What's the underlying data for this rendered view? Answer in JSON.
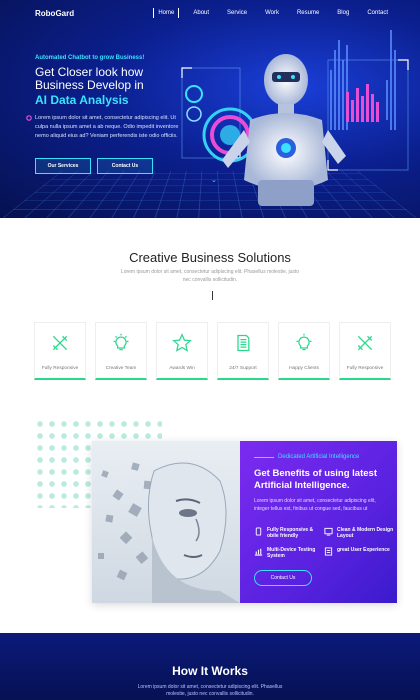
{
  "nav": {
    "logo": "RoboGard",
    "items": [
      "Home",
      "About",
      "Service",
      "Work",
      "Resume",
      "Blog",
      "Contact"
    ]
  },
  "hero": {
    "tagline": "Automated Chatbot to grow Business!",
    "heading_line1": "Get Closer look how",
    "heading_line2": "Business Develop in",
    "heading_highlight": "AI Data Analysis",
    "paragraph": "Lorem ipsum dolor sit amet, consectetur adipiscing elit. Ut culpa nulla ipsum amet a ab neque. Odio impedit inventore nemo aliquid eius ad? Veniam perferendis iste odio officiis.",
    "btn_services": "Our Services",
    "btn_contact": "Contact Us"
  },
  "solutions": {
    "title": "Creative Business Solutions",
    "subtitle": "Lorem ipsum dolor sit amet, consectetur adipiscing elit. Phasellus molestie, justo nec convallis sollicitudin.",
    "features": [
      {
        "label": "Fully Responsive",
        "icon": "tools-icon"
      },
      {
        "label": "Creative Team",
        "icon": "lightbulb-icon"
      },
      {
        "label": "Awards Win",
        "icon": "star-icon"
      },
      {
        "label": "24/7 Support",
        "icon": "document-icon"
      },
      {
        "label": "Happy Clients",
        "icon": "lightbulb-icon"
      },
      {
        "label": "Fully Responsive",
        "icon": "tools-icon"
      }
    ]
  },
  "ai": {
    "tag": "Dedicated Artificial Intelligence",
    "heading": "Get Benefits of using latest Artificial Intelligence.",
    "paragraph": "Lorem ipsum dolor sit amet, consectetur adipiscing elit, integer tellus est, finibus ut congue sed, faucibus ut",
    "features": [
      "Fully Responsive & obile friendly",
      "Clean & Modern Design Layout",
      "Multi-Device Testing System",
      "great User Experience"
    ],
    "button": "Contact Us"
  },
  "how": {
    "title": "How It Works",
    "subtitle": "Lorem ipsum dolor sit amet, consectetur adipiscing elit. Phasellus molestie, justo nec convallis sollicitudin."
  },
  "colors": {
    "accent_cyan": "#39e3ff",
    "accent_green": "#2ad88c",
    "purple": "#6a25e8",
    "navy": "#0b1f8f"
  }
}
